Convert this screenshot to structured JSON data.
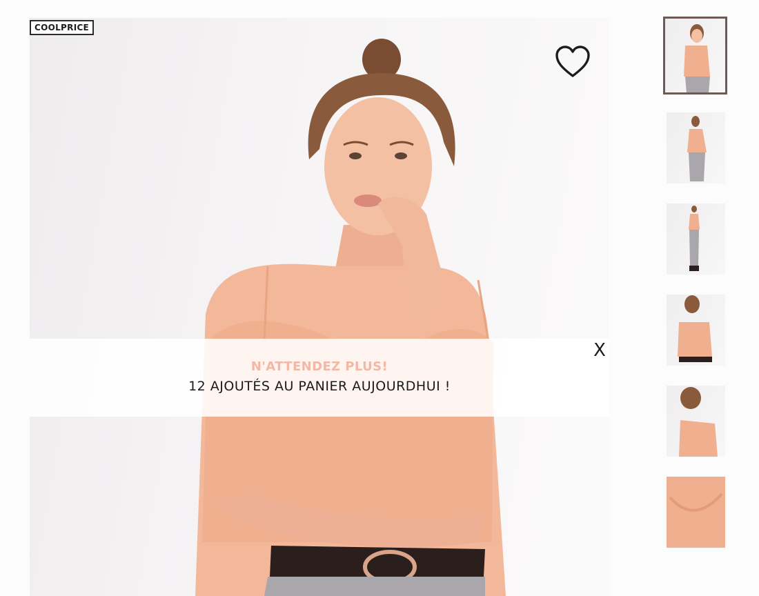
{
  "product": {
    "brand": "COOLPRICE",
    "wishlist_icon": "heart-outline-icon"
  },
  "promo": {
    "headline": "N'ATTENDEZ PLUS!",
    "message": "12 AJOUTÉS AU PANIER AUJOURDHUI !",
    "close_label": "X",
    "headline_color": "#f2b8a5"
  },
  "gallery": {
    "thumbnail_count": 6,
    "active_index": 0
  },
  "colors": {
    "skin": "#f3b79a",
    "top": "#f0b08f",
    "hair": "#8a5a3c",
    "belt": "#2a1f1c",
    "buckle": "#d9a48a"
  }
}
